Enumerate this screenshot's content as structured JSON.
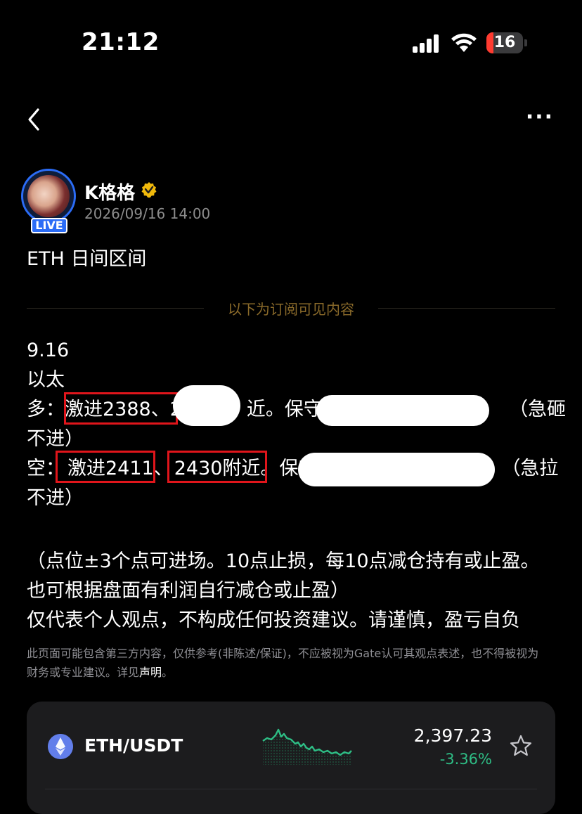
{
  "status_bar": {
    "time": "21:12",
    "battery_level": "16",
    "battery_color": "#ff3b30"
  },
  "nav": {
    "back_icon": "chevron-left-icon",
    "more_label": "···"
  },
  "author": {
    "name": "K格格",
    "live_label": "LIVE",
    "post_time": "2026/09/16 14:00",
    "verified_icon": "verified-badge-icon",
    "accent_color": "#2b6cf6"
  },
  "post": {
    "title": "ETH 日间区间",
    "subscription_divider": "以下为订阅可见内容",
    "date": "9.16",
    "asset": "以太",
    "long_line": {
      "prefix": "多：",
      "aggressive": "激进2388、2",
      "near": "近。保守2",
      "suffix": "（急砸",
      "wrap": "不进）"
    },
    "short_line": {
      "prefix": "空：",
      "aggressive": "激进2411",
      "sep": "、",
      "level": "2430附近",
      "period": "。",
      "conservative": "保守",
      "suffix": "（急拉",
      "wrap": "不进）"
    },
    "notes": [
      "（点位±3个点可进场。10点止损，每10点减仓持有或止盈。",
      "也可根据盘面有利润自行减仓或止盈）",
      "仅代表个人观点，不构成任何投资建议。请谨慎，盈亏自负"
    ],
    "highlight_color": "#e0151b"
  },
  "disclaimer": {
    "text": "此页面可能包含第三方内容，仅供参考(非陈述/保证)，不应被视为Gate认可其观点表述，也不得被视为财务或专业建议。详见",
    "link": "声明",
    "end": "。"
  },
  "ticker_card": {
    "pair": "ETH/USDT",
    "price": "2,397.23",
    "change": "-3.36%",
    "change_color": "#2ebd85",
    "icon": "ethereum-icon",
    "star_icon": "star-outline-icon"
  }
}
